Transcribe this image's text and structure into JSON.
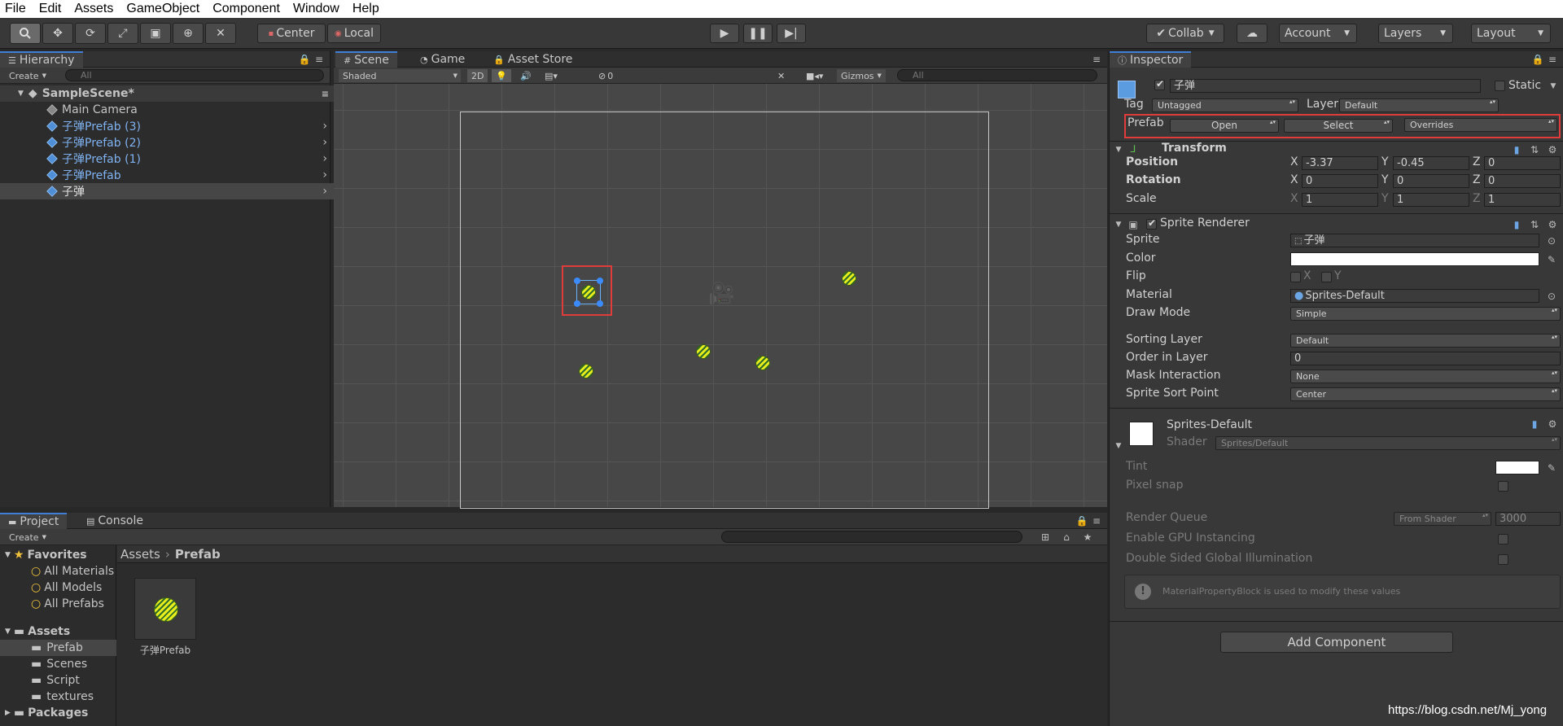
{
  "menu": [
    "File",
    "Edit",
    "Assets",
    "GameObject",
    "Component",
    "Window",
    "Help"
  ],
  "toolbar": {
    "pivot": "Center",
    "space": "Local",
    "collab": "Collab",
    "account": "Account",
    "layers": "Layers",
    "layout": "Layout"
  },
  "hierarchy": {
    "tab": "Hierarchy",
    "create": "Create",
    "search_placeholder": "All",
    "scene": "SampleScene*",
    "items": [
      {
        "label": "Main Camera",
        "prefab": false
      },
      {
        "label": "子弹Prefab (3)",
        "prefab": true
      },
      {
        "label": "子弹Prefab (2)",
        "prefab": true
      },
      {
        "label": "子弹Prefab (1)",
        "prefab": true
      },
      {
        "label": "子弹Prefab",
        "prefab": true
      },
      {
        "label": "子弹",
        "prefab": false,
        "selected": true
      }
    ]
  },
  "scene": {
    "tabs": [
      "Scene",
      "Game",
      "Asset Store"
    ],
    "shading": "Shaded",
    "mode2d": "2D",
    "hidden_count": "0",
    "gizmos": "Gizmos",
    "search_placeholder": "All"
  },
  "project": {
    "tabs": [
      "Project",
      "Console"
    ],
    "create": "Create",
    "favorites": "Favorites",
    "fav_items": [
      "All Materials",
      "All Models",
      "All Prefabs"
    ],
    "assets": "Assets",
    "folders": [
      "Prefab",
      "Scenes",
      "Script",
      "textures"
    ],
    "packages": "Packages",
    "breadcrumb": [
      "Assets",
      "Prefab"
    ],
    "asset_item": "子弹Prefab"
  },
  "inspector": {
    "tab": "Inspector",
    "object_name": "子弹",
    "static": "Static",
    "tag_label": "Tag",
    "tag_value": "Untagged",
    "layer_label": "Layer",
    "layer_value": "Default",
    "prefab_label": "Prefab",
    "open": "Open",
    "select": "Select",
    "overrides": "Overrides",
    "transform": {
      "title": "Transform",
      "position": {
        "label": "Position",
        "x": "-3.37",
        "y": "-0.45",
        "z": "0"
      },
      "rotation": {
        "label": "Rotation",
        "x": "0",
        "y": "0",
        "z": "0"
      },
      "scale": {
        "label": "Scale",
        "x": "1",
        "y": "1",
        "z": "1"
      }
    },
    "sprite_renderer": {
      "title": "Sprite Renderer",
      "sprite_label": "Sprite",
      "sprite_value": "子弹",
      "color_label": "Color",
      "flip_label": "Flip",
      "flip_x": "X",
      "flip_y": "Y",
      "material_label": "Material",
      "material_value": "Sprites-Default",
      "draw_mode_label": "Draw Mode",
      "draw_mode_value": "Simple",
      "sorting_layer_label": "Sorting Layer",
      "sorting_layer_value": "Default",
      "order_label": "Order in Layer",
      "order_value": "0",
      "mask_label": "Mask Interaction",
      "mask_value": "None",
      "sort_point_label": "Sprite Sort Point",
      "sort_point_value": "Center"
    },
    "material": {
      "name": "Sprites-Default",
      "shader_label": "Shader",
      "shader_value": "Sprites/Default",
      "tint": "Tint",
      "pixel_snap": "Pixel snap",
      "render_queue": "Render Queue",
      "render_queue_mode": "From Shader",
      "render_queue_value": "3000",
      "gpu_instancing": "Enable GPU Instancing",
      "double_sided": "Double Sided Global Illumination",
      "info": "MaterialPropertyBlock is used to modify these values"
    },
    "add_component": "Add Component"
  },
  "watermark": "https://blog.csdn.net/Mj_yong",
  "colors": {
    "accent": "#3f7fd6",
    "highlight_box": "#e03c3c",
    "prefab_blue": "#7fb2f0"
  }
}
